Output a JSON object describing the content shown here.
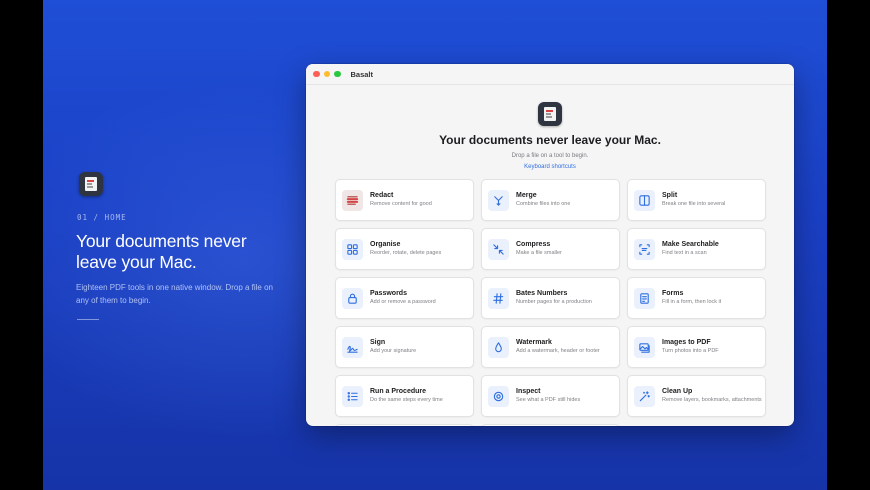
{
  "promo": {
    "kicker": "01 / HOME",
    "title": "Your documents never leave your Mac.",
    "body": "Eighteen PDF tools in one native window. Drop a file on any of them to begin."
  },
  "window": {
    "title": "Basalt",
    "hero_title": "Your documents never leave your Mac.",
    "hero_sub": "Drop a file on a tool to begin.",
    "shortcuts_link": "Keyboard shortcuts"
  },
  "tools": [
    {
      "name": "Redact",
      "desc": "Remove content for good",
      "icon": "redact-icon"
    },
    {
      "name": "Merge",
      "desc": "Combine files into one",
      "icon": "merge-icon"
    },
    {
      "name": "Split",
      "desc": "Break one file into several",
      "icon": "split-icon"
    },
    {
      "name": "Organise",
      "desc": "Reorder, rotate, delete pages",
      "icon": "organise-icon"
    },
    {
      "name": "Compress",
      "desc": "Make a file smaller",
      "icon": "compress-icon"
    },
    {
      "name": "Make Searchable",
      "desc": "Find text in a scan",
      "icon": "scan-icon"
    },
    {
      "name": "Passwords",
      "desc": "Add or remove a password",
      "icon": "lock-icon"
    },
    {
      "name": "Bates Numbers",
      "desc": "Number pages for a production",
      "icon": "hash-icon"
    },
    {
      "name": "Forms",
      "desc": "Fill in a form, then lock it",
      "icon": "form-icon"
    },
    {
      "name": "Sign",
      "desc": "Add your signature",
      "icon": "signature-icon"
    },
    {
      "name": "Watermark",
      "desc": "Add a watermark, header or footer",
      "icon": "drop-icon"
    },
    {
      "name": "Images to PDF",
      "desc": "Turn photos into a PDF",
      "icon": "images-icon"
    },
    {
      "name": "Run a Procedure",
      "desc": "Do the same steps every time",
      "icon": "list-icon"
    },
    {
      "name": "Inspect",
      "desc": "See what a PDF still hides",
      "icon": "inspect-icon"
    },
    {
      "name": "Clean Up",
      "desc": "Remove layers, bookmarks, attachments",
      "icon": "wand-icon"
    }
  ],
  "colors": {
    "accent": "#2f6fe0",
    "backdrop": "#1a3fc4",
    "redact": "#d64545"
  }
}
